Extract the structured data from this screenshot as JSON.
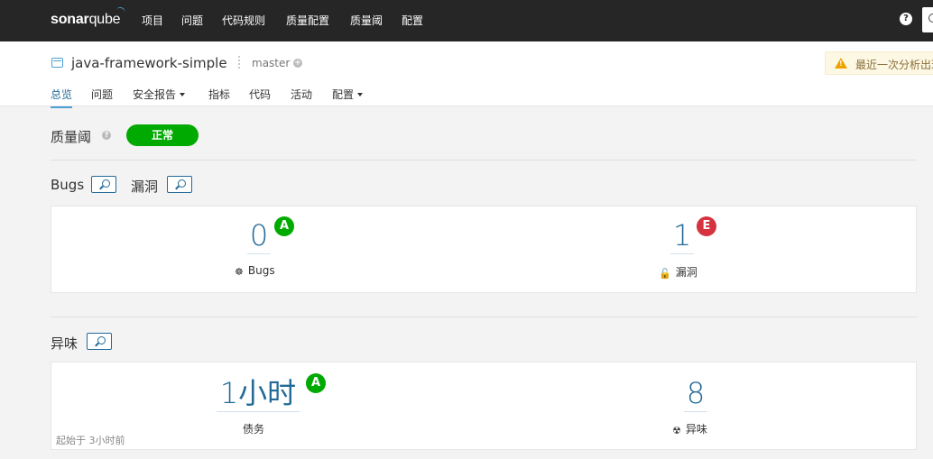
{
  "topbar": {
    "logo_bold": "sonar",
    "logo_light": "qube",
    "nav": [
      "项目",
      "问题",
      "代码规则",
      "质量配置",
      "质量阈",
      "配置"
    ],
    "help_label": "?"
  },
  "project": {
    "name": "java-framework-simple",
    "branch": "master",
    "warning": "最近一次分析出现"
  },
  "tabs": {
    "overview": "总览",
    "issues": "问题",
    "security": "安全报告",
    "measures": "指标",
    "code": "代码",
    "activity": "活动",
    "admin": "配置"
  },
  "quality_gate": {
    "label": "质量阈",
    "status": "正常",
    "status_color": "#00aa00"
  },
  "bugs_section": {
    "title_bugs": "Bugs",
    "title_vuln": "漏洞",
    "bugs": {
      "value": "0",
      "rating": "A",
      "label": "Bugs"
    },
    "vulnerabilities": {
      "value": "1",
      "rating": "E",
      "label": "漏洞"
    }
  },
  "smells_section": {
    "title": "异味",
    "debt": {
      "value": "1小时",
      "rating": "A",
      "label": "债务"
    },
    "code_smells": {
      "value": "8",
      "label": "异味"
    },
    "since": "起始于 3小时前"
  },
  "colors": {
    "rating_a": "#00aa00",
    "rating_e": "#d4333f",
    "link": "#236a97"
  }
}
